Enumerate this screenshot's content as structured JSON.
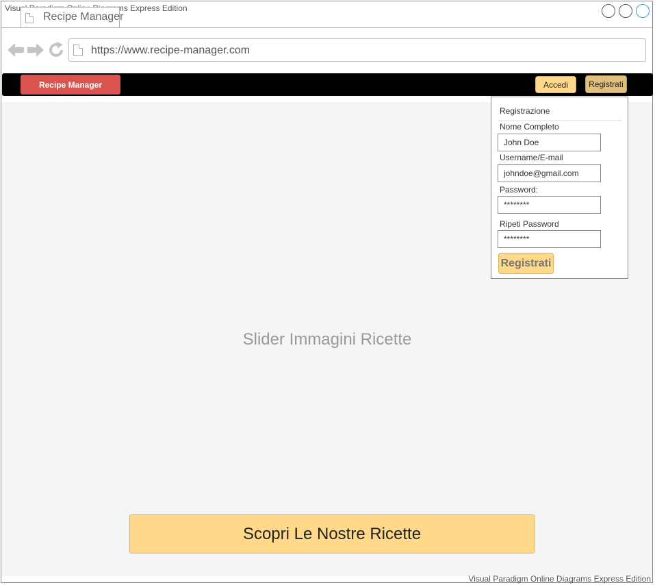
{
  "watermark": {
    "top": "Visual Paradigm Online Diagrams Express Edition",
    "bottom": "Visual Paradigm Online Diagrams Express Edition"
  },
  "browser": {
    "tab_title": "Recipe Manager",
    "url": "https://www.recipe-manager.com",
    "icons": [
      "back-arrow-icon",
      "forward-arrow-icon",
      "refresh-icon",
      "page-icon"
    ]
  },
  "navbar": {
    "brand_label": "Recipe Manager",
    "login_label": "Accedi",
    "register_label": "Registrati"
  },
  "registration": {
    "title": "Registrazione",
    "fields": [
      {
        "label": "Nome Completo",
        "value": "John Doe"
      },
      {
        "label": "Username/E-mail",
        "value": "johndoe@gmail.com"
      },
      {
        "label": "Password:",
        "value": "********"
      },
      {
        "label": "Ripeti Password",
        "value": "********"
      }
    ],
    "submit_label": "Registrati"
  },
  "main": {
    "slider_text": "Slider Immagini Ricette",
    "cta_label": "Scopri Le Nostre Ricette"
  },
  "colors": {
    "brand": "#d9534f",
    "accent": "#ffd88a",
    "navbar": "#000000",
    "slider_bg": "#f5f5f5"
  }
}
